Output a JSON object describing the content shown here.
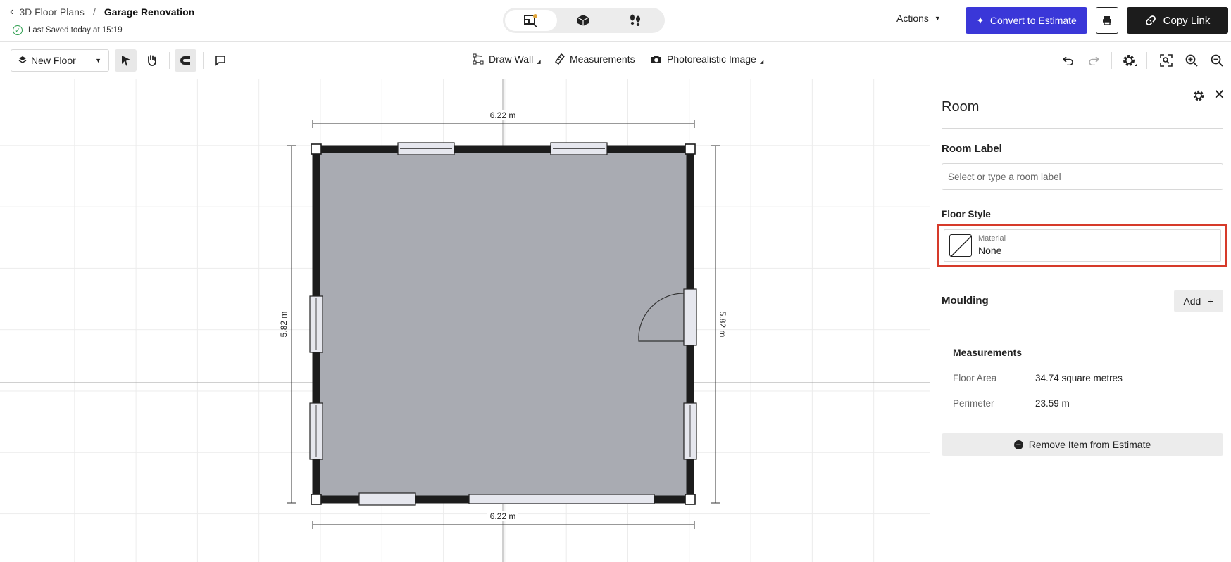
{
  "header": {
    "breadcrumb_parent": "3D Floor Plans",
    "breadcrumb_sep": "/",
    "breadcrumb_current": "Garage Renovation",
    "saved_status": "Last Saved today at 15:19",
    "view_modes": [
      "2d-plan-icon",
      "3d-box-icon",
      "footsteps-icon"
    ],
    "actions_label": "Actions",
    "convert_label": "Convert to Estimate",
    "copy_link_label": "Copy Link",
    "accent_color": "#3a37d8"
  },
  "toolbar": {
    "floor_select_label": "New Floor",
    "draw_wall_label": "Draw Wall",
    "measurements_label": "Measurements",
    "photo_label": "Photorealistic Image"
  },
  "plan": {
    "width_label": "6.22 m",
    "height_label": "5.82 m",
    "room_fill": "#a9abb2",
    "wall_color": "#1c1c1c"
  },
  "panel": {
    "title": "Room",
    "room_label_heading": "Room Label",
    "room_label_placeholder": "Select or type a room label",
    "floor_style_heading": "Floor Style",
    "material_caption": "Material",
    "material_value": "None",
    "highlight_color": "#d63a2a",
    "moulding_heading": "Moulding",
    "add_label": "Add",
    "measurements_heading": "Measurements",
    "measurements": [
      {
        "key": "Floor Area",
        "value": "34.74 square metres"
      },
      {
        "key": "Perimeter",
        "value": "23.59 m"
      }
    ],
    "remove_label": "Remove Item from Estimate"
  }
}
